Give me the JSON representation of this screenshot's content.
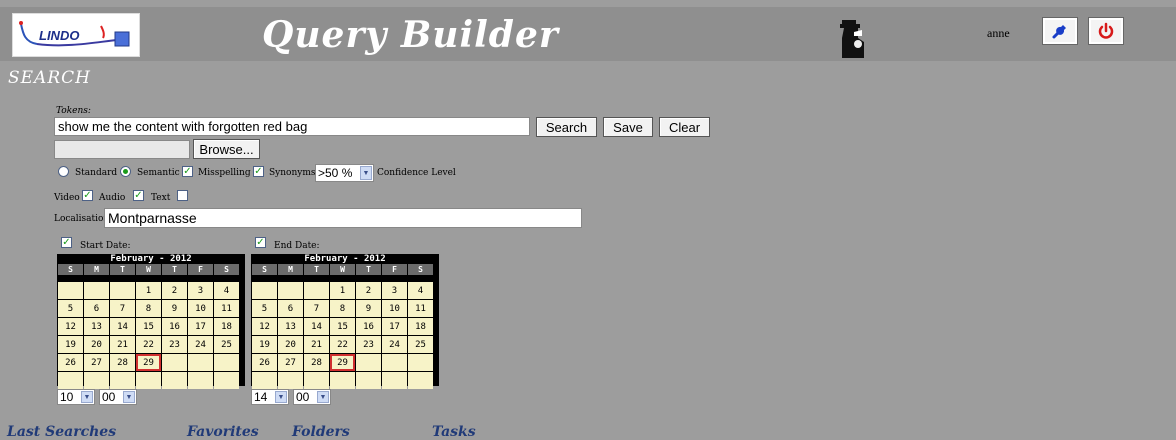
{
  "header": {
    "logo_text": "LINDO",
    "title": "Query Builder",
    "username": "anne",
    "settings_icon": "wrench-icon",
    "logout_icon": "power-icon"
  },
  "search": {
    "section_title": "SEARCH",
    "tokens_label": "Tokens:",
    "tokens_value": "show me the content with forgotten red bag",
    "search_button": "Search",
    "save_button": "Save",
    "clear_button": "Clear",
    "file_value": "",
    "browse_button": "Browse...",
    "mode_standard": "Standard",
    "mode_semantic": "Semantic",
    "mode_selected": "Semantic",
    "misspelling_label": "Misspelling",
    "misspelling_checked": true,
    "synonyms_label": "Synonyms",
    "synonyms_checked": true,
    "confidence_value": ">50 %",
    "confidence_label": "Confidence Level",
    "video_label": "Video",
    "video_checked": true,
    "audio_label": "Audio",
    "audio_checked": true,
    "text_label": "Text",
    "text_checked": false,
    "localisation_label": "Localisation:",
    "localisation_value": "Montparnasse"
  },
  "start_date": {
    "label": "Start Date:",
    "checked": true,
    "month": "February - 2012",
    "hour": "10",
    "minute": "00"
  },
  "end_date": {
    "label": "End Date:",
    "checked": true,
    "month": "February - 2012",
    "hour": "14",
    "minute": "00"
  },
  "calendar": {
    "dow": [
      "S",
      "M",
      "T",
      "W",
      "T",
      "F",
      "S"
    ],
    "weeks": [
      [
        "",
        "",
        "",
        "1",
        "2",
        "3",
        "4"
      ],
      [
        "5",
        "6",
        "7",
        "8",
        "9",
        "10",
        "11"
      ],
      [
        "12",
        "13",
        "14",
        "15",
        "16",
        "17",
        "18"
      ],
      [
        "19",
        "20",
        "21",
        "22",
        "23",
        "24",
        "25"
      ],
      [
        "26",
        "27",
        "28",
        "29",
        "",
        "",
        ""
      ],
      [
        "",
        "",
        "",
        "",
        "",
        "",
        ""
      ]
    ],
    "today": "29"
  },
  "bottom_nav": [
    "Last Searches",
    "Favorites",
    "Folders",
    "Tasks"
  ]
}
